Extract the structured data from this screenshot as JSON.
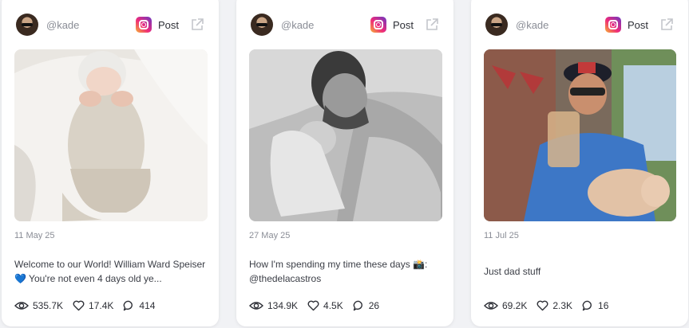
{
  "cards": [
    {
      "handle": "@kade",
      "platform_icon": "instagram-icon",
      "post_label": "Post",
      "date": "11 May 25",
      "caption": "Welcome to our World! William Ward Speiser 💙  You're not even 4 days old ye...",
      "views": "535.7K",
      "likes": "17.4K",
      "comments": "414"
    },
    {
      "handle": "@kade",
      "platform_icon": "instagram-icon",
      "post_label": "Post",
      "date": "27 May 25",
      "caption": "How I'm spending my time these days 📸: @thedelacastros",
      "views": "134.9K",
      "likes": "4.5K",
      "comments": "26"
    },
    {
      "handle": "@kade",
      "platform_icon": "instagram-icon",
      "post_label": "Post",
      "date": "11 Jul 25",
      "caption": "Just dad stuff",
      "views": "69.2K",
      "likes": "2.3K",
      "comments": "16"
    }
  ]
}
